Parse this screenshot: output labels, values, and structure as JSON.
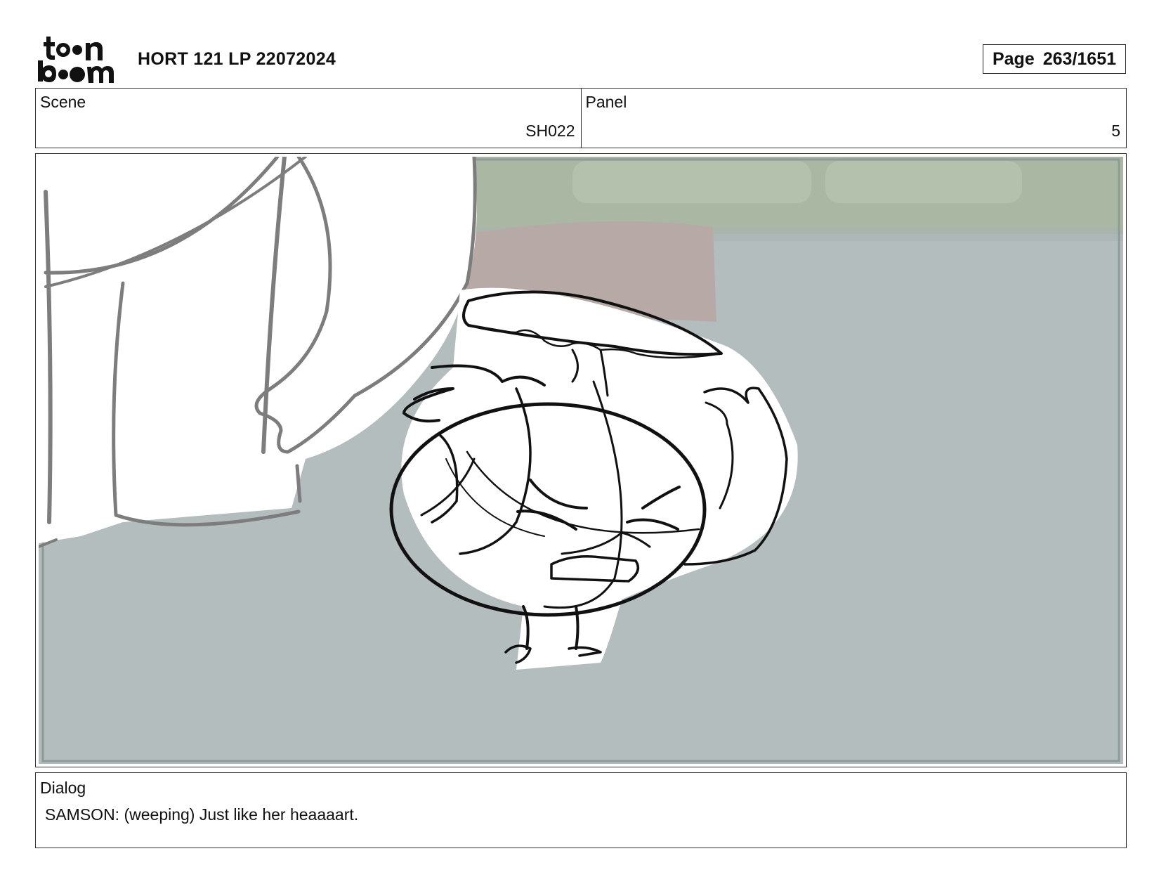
{
  "header": {
    "logo": {
      "icon": "toonboom-logo-icon",
      "line1": "to•n",
      "line2": "b••m"
    },
    "title": "HORT 121 LP 22072024",
    "page_label": "Page",
    "page_number": "263/1651"
  },
  "info": {
    "scene_label": "Scene",
    "scene_value": "SH022",
    "panel_label": "Panel",
    "panel_value": "5"
  },
  "panel_image": {
    "icon": "storyboard-sketch",
    "colors": {
      "background_floor": "#b3bdbd",
      "wall": "#a9b7a3",
      "cushion": "#b6a9a6",
      "line": "#111111",
      "sketch_gray": "#7a7a7a"
    }
  },
  "dialog": {
    "label": "Dialog",
    "text": "SAMSON: (weeping) Just like her heaaaart."
  }
}
